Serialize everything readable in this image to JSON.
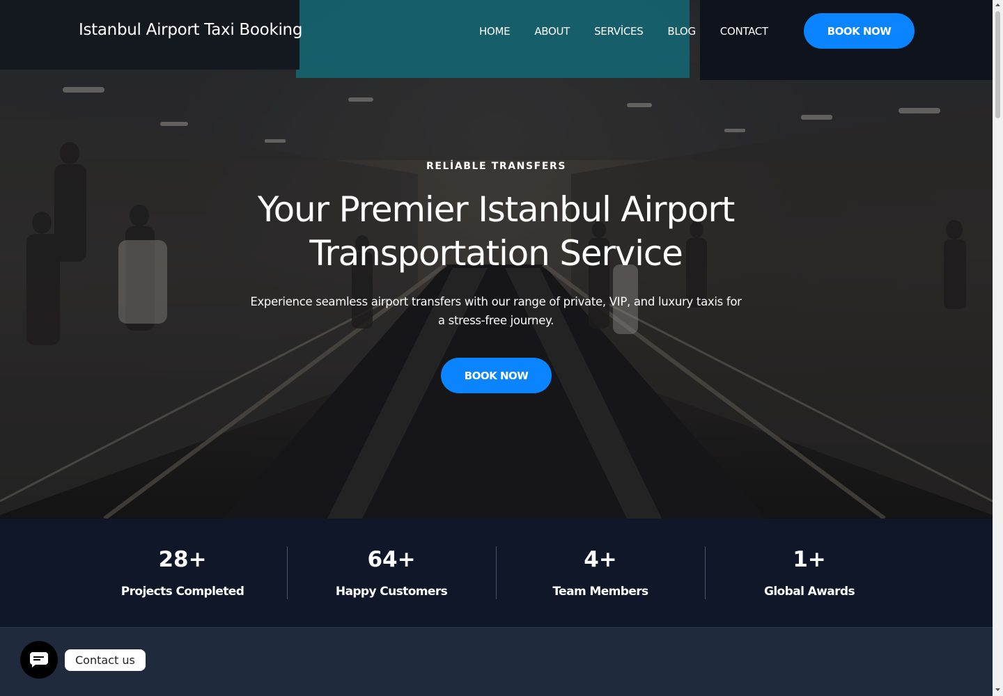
{
  "brand": {
    "title": "Istanbul Airport Taxi Booking"
  },
  "nav": {
    "items": [
      "HOME",
      "ABOUT",
      "SERVİCES",
      "BLOG",
      "CONTACT"
    ],
    "cta": "BOOK NOW"
  },
  "hero": {
    "eyebrow": "RELİABLE TRANSFERS",
    "headline_line1": "Your Premier Istanbul Airport",
    "headline_line2": "Transportation Service",
    "subtext": "Experience seamless airport transfers with our range of private, VIP, and luxury taxis for a stress-free journey.",
    "cta": "BOOK NOW"
  },
  "stats": [
    {
      "value": "28+",
      "label": "Projects Completed"
    },
    {
      "value": "64+",
      "label": "Happy Customers"
    },
    {
      "value": "4+",
      "label": "Team Members"
    },
    {
      "value": "1+",
      "label": "Global Awards"
    }
  ],
  "chat": {
    "label": "Contact us",
    "icon": "chat-bubble-icon"
  },
  "colors": {
    "accent": "#0a84ff",
    "stats_bg": "#0f1729",
    "page_bg": "#1f2a3c",
    "sign_teal": "#1a9aa8"
  }
}
